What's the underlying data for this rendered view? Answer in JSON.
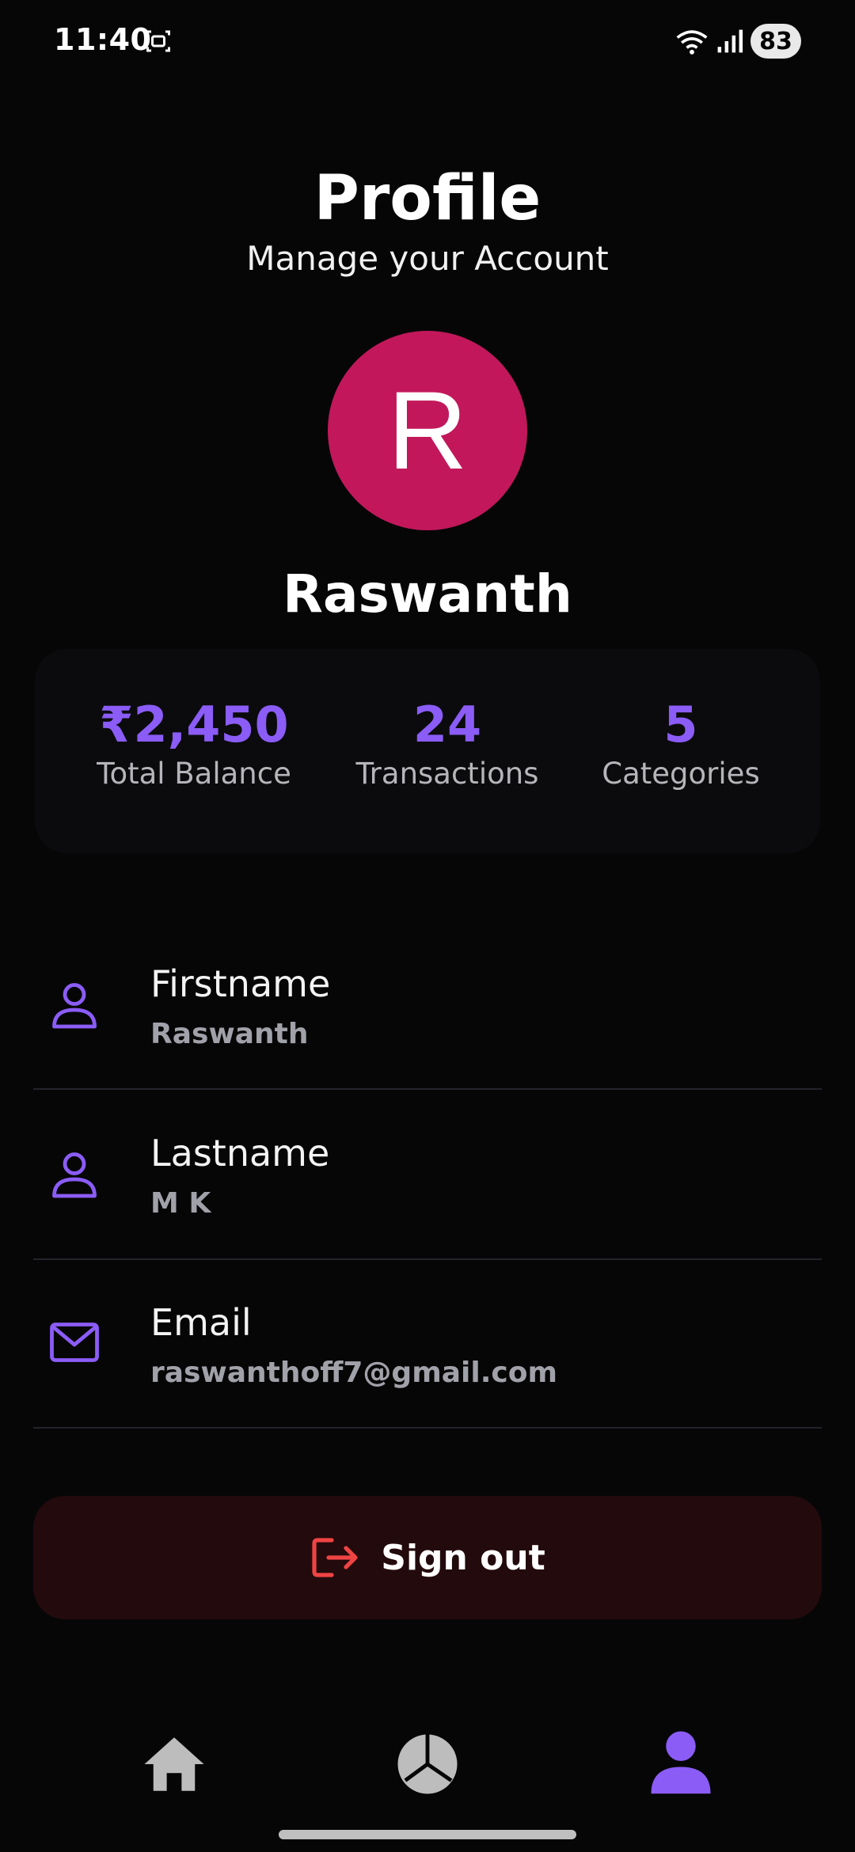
{
  "status": {
    "time": "11:40",
    "battery": "83",
    "icons": [
      "screenshot-icon",
      "wifi-icon",
      "signal-icon",
      "battery-icon"
    ]
  },
  "header": {
    "title": "Profile",
    "subtitle": "Manage your Account"
  },
  "profile": {
    "avatar_letter": "R",
    "avatar_color": "#c2185b",
    "name": "Raswanth"
  },
  "stats": [
    {
      "value": "₹2,450",
      "label": "Total Balance"
    },
    {
      "value": "24",
      "label": "Transactions"
    },
    {
      "value": "5",
      "label": "Categories"
    }
  ],
  "fields": [
    {
      "label": "Firstname",
      "value": "Raswanth",
      "icon": "person-icon"
    },
    {
      "label": "Lastname",
      "value": "M K",
      "icon": "person-icon"
    },
    {
      "label": "Email",
      "value": "raswanthoff7@gmail.com",
      "icon": "mail-icon"
    }
  ],
  "signout": {
    "label": "Sign out",
    "icon": "logout-icon",
    "color": "#ef4444"
  },
  "nav": {
    "items": [
      {
        "name": "home",
        "icon": "home-icon",
        "active": false
      },
      {
        "name": "stats",
        "icon": "pie-chart-icon",
        "active": false
      },
      {
        "name": "profile",
        "icon": "user-icon",
        "active": true
      }
    ],
    "active_color": "#8b5cf6",
    "inactive_color": "#bdbdbd"
  },
  "colors": {
    "accent": "#8b5cf6",
    "background": "#060607"
  }
}
